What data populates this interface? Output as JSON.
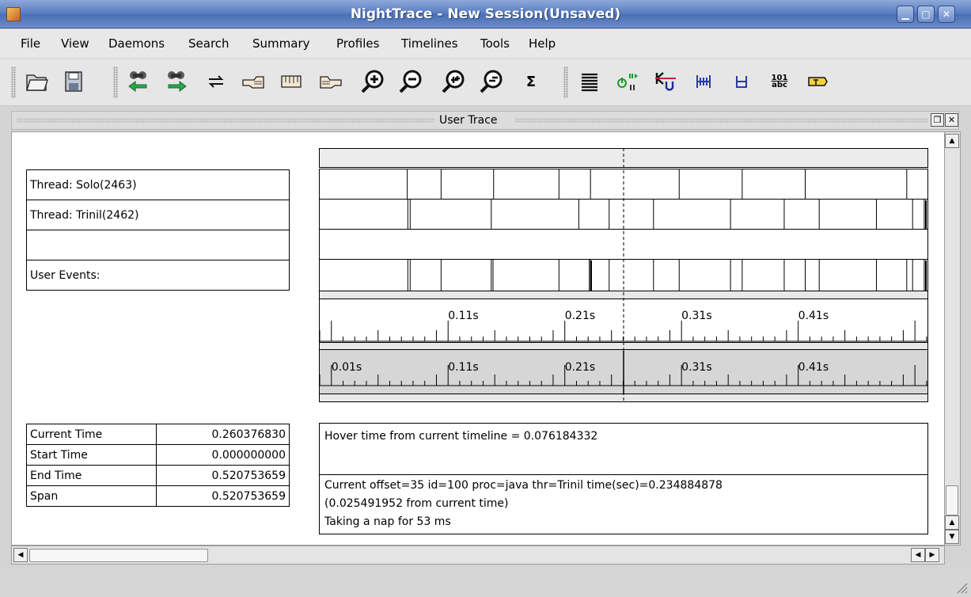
{
  "window": {
    "title": "NightTrace - New Session(Unsaved)"
  },
  "menu": [
    "File",
    "View",
    "Daemons",
    "Search",
    "Summary",
    "Profiles",
    "Timelines",
    "Tools",
    "Help"
  ],
  "toolbar": {
    "icons": [
      "open-folder-icon",
      "save-disk-icon",
      "search-back-icon",
      "search-forward-icon",
      "swap-icon",
      "hand-left-icon",
      "hand-grab-icon",
      "hand-right-icon",
      "zoom-in-icon",
      "zoom-out-icon",
      "zoom-in-fast-icon",
      "zoom-out-fast-icon",
      "sigma-icon",
      "list-icon",
      "power-pause-icon",
      "kernel-user-icon",
      "interval-icon",
      "interval-small-icon",
      "binary-text-icon",
      "tag-icon"
    ],
    "sigma": "Σ",
    "binary_top": "101",
    "binary_bottom": "abc"
  },
  "dock": {
    "title": "User Trace"
  },
  "rows": [
    "Thread: Solo(2463)",
    "Thread: Trinil(2462)",
    "",
    "User Events:"
  ],
  "time_table": [
    {
      "label": "Current Time",
      "value": "0.260376830"
    },
    {
      "label": "Start Time",
      "value": "0.000000000"
    },
    {
      "label": "End Time",
      "value": "0.520753659"
    },
    {
      "label": "Span",
      "value": "0.520753659"
    }
  ],
  "timeline": {
    "start": 0.0,
    "end": 0.520753659,
    "current": 0.26037683,
    "ruler_labels_top": [
      "0.11s",
      "0.21s",
      "0.31s",
      "0.41s"
    ],
    "ruler_labels_bottom": [
      "0.01s",
      "0.11s",
      "0.21s",
      "0.31s",
      "0.41s"
    ],
    "solo_events": [
      0.075,
      0.104,
      0.149,
      0.205,
      0.232,
      0.308,
      0.362,
      0.416,
      0.503
    ],
    "trinil_events": [
      0.0755,
      0.0775,
      0.147,
      0.222,
      0.248,
      0.286,
      0.352,
      0.398,
      0.428,
      0.477,
      0.508,
      0.518
    ],
    "user_events": [
      0.0755,
      0.0775,
      0.104,
      0.147,
      0.1485,
      0.205,
      0.231,
      0.232,
      0.248,
      0.286,
      0.308,
      0.352,
      0.362,
      0.398,
      0.416,
      0.428,
      0.477,
      0.503,
      0.508,
      0.518
    ]
  },
  "info": {
    "hover": "Hover time from current timeline = 0.076184332",
    "lines": [
      "Current offset=35  id=100  proc=java  thr=Trinil  time(sec)=0.234884878",
      "(0.025491952 from current time)",
      "Taking a nap for 53 ms"
    ]
  }
}
